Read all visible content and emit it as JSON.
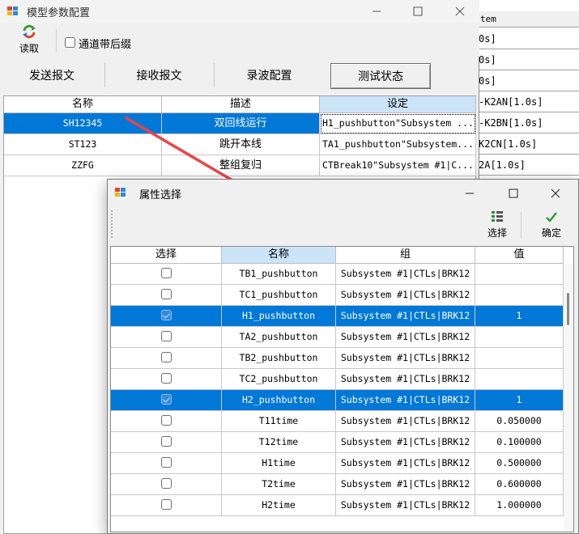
{
  "main_window": {
    "title": "模型参数配置",
    "read_label": "读取",
    "channel_suffix_label": "通道带后缀",
    "tabs": [
      "发送报文",
      "接收报文",
      "录波配置",
      "测试状态"
    ],
    "grid": {
      "headers": [
        "名称",
        "描述",
        "设定"
      ],
      "rows": [
        {
          "name": "SH12345",
          "desc": "双回线运行",
          "setting": "H1_pushbutton\"Subsystem ...",
          "selected": true
        },
        {
          "name": "ST123",
          "desc": "跳开本线",
          "setting": "TA1_pushbutton\"Subsystem...",
          "selected": false
        },
        {
          "name": "ZZFG",
          "desc": "整组复归",
          "setting": "CTBreak10\"Subsystem #1|C...",
          "selected": false
        }
      ]
    }
  },
  "background_table": {
    "header": "tem",
    "rows": [
      "0s]",
      "0s]",
      "0s]",
      "-K2AN[1.0s]",
      "-K2BN[1.0s]",
      "K2CN[1.0s]",
      "2A[1.0s]"
    ]
  },
  "dialog": {
    "title": "属性选择",
    "select_label": "选择",
    "ok_label": "确定",
    "headers": [
      "选择",
      "名称",
      "组",
      "值"
    ],
    "rows": [
      {
        "checked": false,
        "name": "TB1_pushbutton",
        "group": "Subsystem #1|CTLs|BRK12",
        "value": "",
        "selected": false
      },
      {
        "checked": false,
        "name": "TC1_pushbutton",
        "group": "Subsystem #1|CTLs|BRK12",
        "value": "",
        "selected": false
      },
      {
        "checked": true,
        "name": "H1_pushbutton",
        "group": "Subsystem #1|CTLs|BRK12",
        "value": "1",
        "selected": true
      },
      {
        "checked": false,
        "name": "TA2_pushbutton",
        "group": "Subsystem #1|CTLs|BRK12",
        "value": "",
        "selected": false
      },
      {
        "checked": false,
        "name": "TB2_pushbutton",
        "group": "Subsystem #1|CTLs|BRK12",
        "value": "",
        "selected": false
      },
      {
        "checked": false,
        "name": "TC2_pushbutton",
        "group": "Subsystem #1|CTLs|BRK12",
        "value": "",
        "selected": false
      },
      {
        "checked": true,
        "name": "H2_pushbutton",
        "group": "Subsystem #1|CTLs|BRK12",
        "value": "1",
        "selected": true
      },
      {
        "checked": false,
        "name": "T11time",
        "group": "Subsystem #1|CTLs|BRK12",
        "value": "0.050000",
        "selected": false
      },
      {
        "checked": false,
        "name": "T12time",
        "group": "Subsystem #1|CTLs|BRK12",
        "value": "0.100000",
        "selected": false
      },
      {
        "checked": false,
        "name": "H1time",
        "group": "Subsystem #1|CTLs|BRK12",
        "value": "0.500000",
        "selected": false
      },
      {
        "checked": false,
        "name": "T2time",
        "group": "Subsystem #1|CTLs|BRK12",
        "value": "0.600000",
        "selected": false
      },
      {
        "checked": false,
        "name": "H2time",
        "group": "Subsystem #1|CTLs|BRK12",
        "value": "1.000000",
        "selected": false
      }
    ]
  },
  "colors": {
    "selection": "#0078d7",
    "header_selected": "#cce4f7",
    "arrow": "#e8454a"
  },
  "icons": [
    "app-window-icon",
    "refresh-icon",
    "minimize-icon",
    "maximize-icon",
    "close-icon",
    "select-list-icon",
    "checkmark-icon",
    "red-arrow-annotation"
  ]
}
